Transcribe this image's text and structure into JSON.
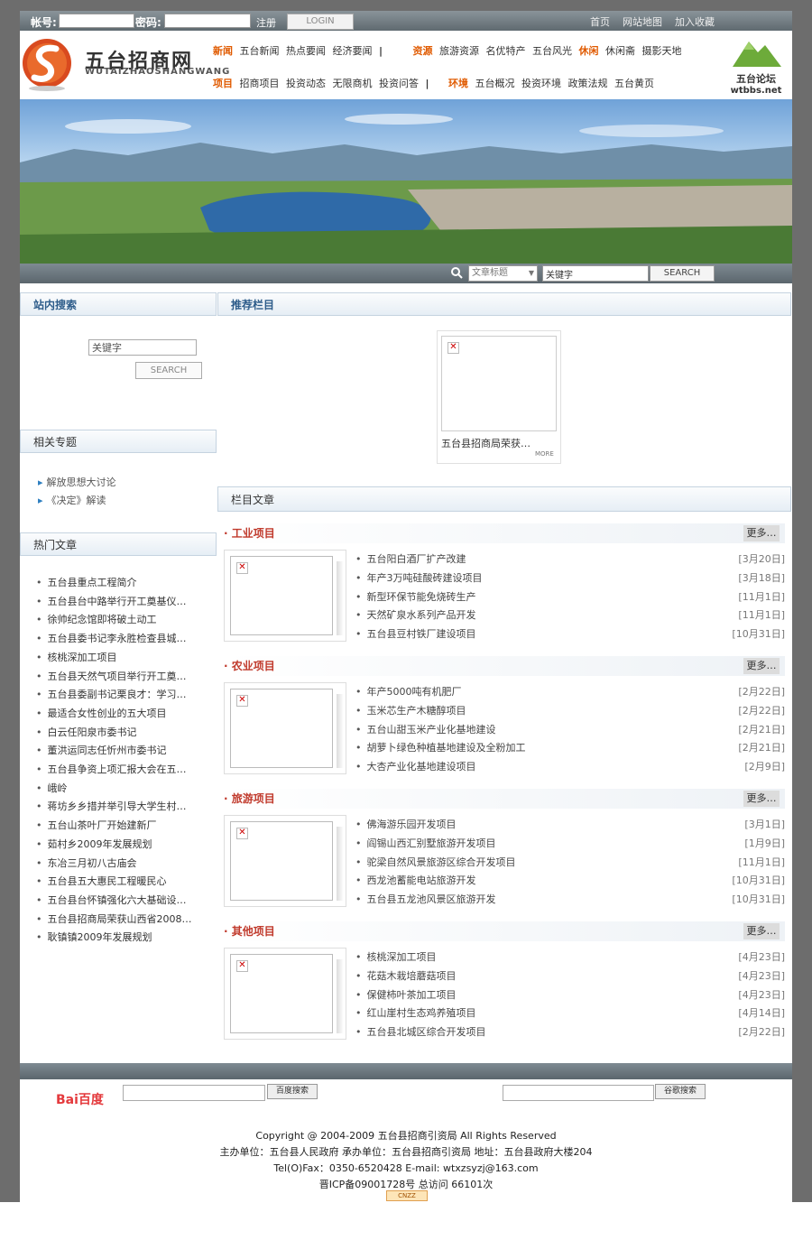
{
  "login": {
    "account_label": "帐号:",
    "password_label": "密码:",
    "register": "注册",
    "login_button": "LOGIN",
    "links": [
      "首页",
      "网站地图",
      "加入收藏"
    ]
  },
  "header": {
    "brand_cn": "五台招商网",
    "brand_en": "WUTAIZHAOSHANGWANG",
    "nav_row1": [
      {
        "cat": "新闻",
        "items": [
          "五台新闻",
          "热点要闻",
          "经济要闻"
        ],
        "sep": "|"
      },
      {
        "cat": "资源",
        "items": [
          "旅游资源",
          "名优特产",
          "五台风光"
        ]
      },
      {
        "cat": "休闲",
        "items": [
          "休闲斋",
          "摄影天地"
        ]
      }
    ],
    "nav_row2": [
      {
        "cat": "项目",
        "items": [
          "招商项目",
          "投资动态",
          "无限商机",
          "投资问答"
        ],
        "sep": "|"
      },
      {
        "cat": "环境",
        "items": [
          "五台概况",
          "投资环境",
          "政策法规",
          "五台黄页"
        ]
      }
    ],
    "forum_cn": "五台论坛",
    "forum_en": "wtbbs.net"
  },
  "search_strip": {
    "select_value": "文章标题",
    "keyword_value": "关键字",
    "button": "SEARCH"
  },
  "left": {
    "site_search_title": "站内搜索",
    "search_input_value": "关键字",
    "search_button": "SEARCH",
    "topics_title": "相关专题",
    "topics": [
      "解放思想大讨论",
      "《决定》解读"
    ],
    "hot_title": "热门文章",
    "hot": [
      "五台县重点工程简介",
      "五台县台中路举行开工奠基仪…",
      "徐帅纪念馆即将破土动工",
      "五台县委书记李永胜检查县城…",
      "核桃深加工项目",
      "五台县天然气项目举行开工奠…",
      "五台县委副书记栗良才：学习…",
      "最适合女性创业的五大项目",
      "白云任阳泉市委书记",
      "董洪运同志任忻州市委书记",
      "五台县争资上项汇报大会在五…",
      "峨岭",
      "蒋坊乡乡措并举引导大学生村…",
      "五台山茶叶厂开始建新厂",
      "茹村乡2009年发展规划",
      "东冶三月初八古庙会",
      "五台县五大惠民工程暖民心",
      "五台县台怀镇强化六大基础设…",
      "五台县招商局荣获山西省2008…",
      "耿镇镇2009年发展规划"
    ]
  },
  "right": {
    "recommended_title": "推荐栏目",
    "recommended_caption": "五台县招商局荣获…",
    "recommended_more": "MORE",
    "articles_title": "栏目文章",
    "more_label": "更多…",
    "sections": [
      {
        "title": "· 工业项目",
        "items": [
          {
            "t": "五台阳白酒厂扩产改建",
            "d": "[3月20日]"
          },
          {
            "t": "年产3万吨硅酸砖建设项目",
            "d": "[3月18日]"
          },
          {
            "t": "新型环保节能免烧砖生产",
            "d": "[11月1日]"
          },
          {
            "t": "天然矿泉水系列产品开发",
            "d": "[11月1日]"
          },
          {
            "t": "五台县豆村铁厂建设项目",
            "d": "[10月31日]"
          }
        ]
      },
      {
        "title": "· 农业项目",
        "items": [
          {
            "t": "年产5000吨有机肥厂",
            "d": "[2月22日]"
          },
          {
            "t": "玉米芯生产木糖醇项目",
            "d": "[2月22日]"
          },
          {
            "t": "五台山甜玉米产业化基地建设",
            "d": "[2月21日]"
          },
          {
            "t": "胡萝卜绿色种植基地建设及全粉加工",
            "d": "[2月21日]"
          },
          {
            "t": "大杏产业化基地建设项目",
            "d": "[2月9日]"
          }
        ]
      },
      {
        "title": "· 旅游项目",
        "items": [
          {
            "t": "佛海游乐园开发项目",
            "d": "[3月1日]"
          },
          {
            "t": "阎锡山西汇别墅旅游开发项目",
            "d": "[1月9日]"
          },
          {
            "t": "驼梁自然风景旅游区综合开发项目",
            "d": "[11月1日]"
          },
          {
            "t": "西龙池蓄能电站旅游开发",
            "d": "[10月31日]"
          },
          {
            "t": "五台县五龙池风景区旅游开发",
            "d": "[10月31日]"
          }
        ]
      },
      {
        "title": "· 其他项目",
        "items": [
          {
            "t": "核桃深加工项目",
            "d": "[4月23日]"
          },
          {
            "t": "花菇木栽培蘑菇项目",
            "d": "[4月23日]"
          },
          {
            "t": "保健柿叶茶加工项目",
            "d": "[4月23日]"
          },
          {
            "t": "红山崖村生态鸡养殖项目",
            "d": "[4月14日]"
          },
          {
            "t": "五台县北城区综合开发项目",
            "d": "[2月22日]"
          }
        ]
      }
    ]
  },
  "footer": {
    "baidu_logo": "Bai百度",
    "baidu_button": "百度搜索",
    "google_button": "谷歌搜索",
    "lines": [
      "Copyright @ 2004-2009 五台县招商引资局  All Rights Reserved",
      "主办单位：五台县人民政府    承办单位：五台县招商引资局      地址：五台县政府大楼204",
      "Tel(O)Fax：0350-6520428 E-mail: wtxzsyzj@163.com",
      "晋ICP备09001728号   总访问 66101次"
    ],
    "cnzz": "CNZZ"
  },
  "colors": {
    "accent_orange": "#e05a00",
    "section_red": "#c0392b",
    "title_blue": "#2d5c8a"
  }
}
